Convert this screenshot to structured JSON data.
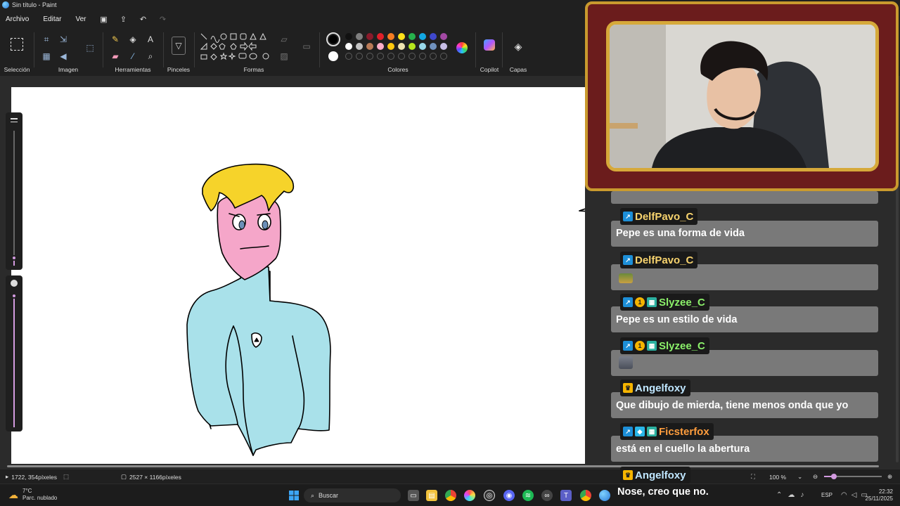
{
  "window": {
    "title": "Sin título - Paint"
  },
  "menu": {
    "file": "Archivo",
    "edit": "Editar",
    "view": "Ver"
  },
  "ribbon": {
    "groups": {
      "selection": "Selección",
      "image": "Imagen",
      "tools": "Herramientas",
      "brushes": "Pinceles",
      "shapes": "Formas",
      "colors": "Colores",
      "copilot": "Copilot",
      "layers": "Capas"
    },
    "palette_top": [
      "#111111",
      "#7f7f7f",
      "#8b1a2b",
      "#e0202a",
      "#f77d22",
      "#ffe21a",
      "#26b14c",
      "#12a7e3",
      "#3f48cc",
      "#a349a4"
    ],
    "palette_mid": [
      "#ffffff",
      "#c3c3c3",
      "#b97a57",
      "#ffaec9",
      "#ffc90e",
      "#efe4b0",
      "#b5e61d",
      "#99d9ea",
      "#7092be",
      "#c8bfe7"
    ],
    "primary_color": "#000000",
    "secondary_color": "#ffffff"
  },
  "status": {
    "cursor_pos": "1722, 354píxeles",
    "canvas_size": "2527 × 1166píxeles",
    "zoom": "100 %"
  },
  "taskbar": {
    "weather_temp": "7°C",
    "weather_desc": "Parc. nublado",
    "search_placeholder": "Buscar",
    "lang": "ESP",
    "time": "22:32",
    "date": "25/11/2025"
  },
  "chat": {
    "messages": [
      {
        "user": "DelfPavo_C",
        "text": "Pepe es una forma de vida",
        "color": "#f7d36e"
      },
      {
        "user": "DelfPavo_C",
        "text": "",
        "color": "#f7d36e"
      },
      {
        "user": "Slyzee_C",
        "text": "Pepe es un estilo de vida",
        "color": "#8bf06a"
      },
      {
        "user": "Slyzee_C",
        "text": "",
        "color": "#8bf06a"
      },
      {
        "user": "Angelfoxy",
        "text": "Que dibujo de mierda, tiene menos onda que yo",
        "color": "#bfe6ff"
      },
      {
        "user": "Ficsterfox",
        "text": "está en el cuello la abertura",
        "color": "#ff9d3d"
      },
      {
        "user": "Angelfoxy",
        "text": "Nose, creo que no.",
        "color": "#bfe6ff"
      }
    ]
  }
}
